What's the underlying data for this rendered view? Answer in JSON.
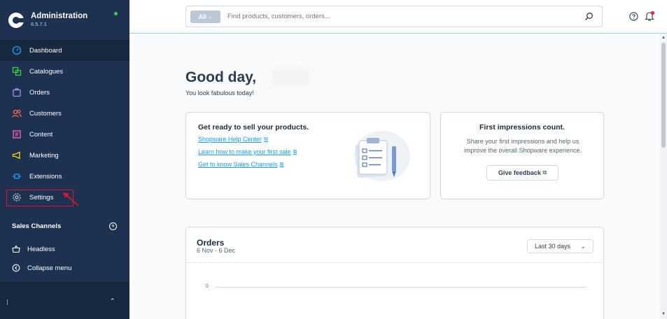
{
  "sidebar": {
    "title": "Administration",
    "version": "6.5.7.1",
    "items": [
      {
        "label": "Dashboard",
        "icon": "dashboard-icon"
      },
      {
        "label": "Catalogues",
        "icon": "catalogue-icon"
      },
      {
        "label": "Orders",
        "icon": "orders-icon"
      },
      {
        "label": "Customers",
        "icon": "customers-icon"
      },
      {
        "label": "Content",
        "icon": "content-icon"
      },
      {
        "label": "Marketing",
        "icon": "marketing-icon"
      },
      {
        "label": "Extensions",
        "icon": "extensions-icon"
      },
      {
        "label": "Settings",
        "icon": "gear-icon"
      }
    ],
    "sales_channels_label": "Sales Channels",
    "sales_channels": [
      {
        "label": "Headless",
        "icon": "basket-icon"
      }
    ],
    "collapse_label": "Collapse menu",
    "accent_color": "#189eff",
    "icon_color_orange": "#ff6e52"
  },
  "topbar": {
    "search_scope": "All",
    "search_placeholder": "Find products, customers, orders..."
  },
  "greeting": {
    "title": "Good day,",
    "subtitle": "You look fabulous today!"
  },
  "sell_card": {
    "title": "Get ready to sell your products.",
    "links": [
      "Shopware Help Center",
      "Learn how to make your first sale",
      "Get to know Sales Channels"
    ]
  },
  "feedback_card": {
    "title": "First impressions count.",
    "text": "Share your first impressions and help us improve the overall Shopware experience.",
    "button": "Give feedback"
  },
  "orders_card": {
    "title": "Orders",
    "range": "6 Nov - 6 Dec",
    "period": "Last 30 days",
    "axis_zero": "0"
  }
}
